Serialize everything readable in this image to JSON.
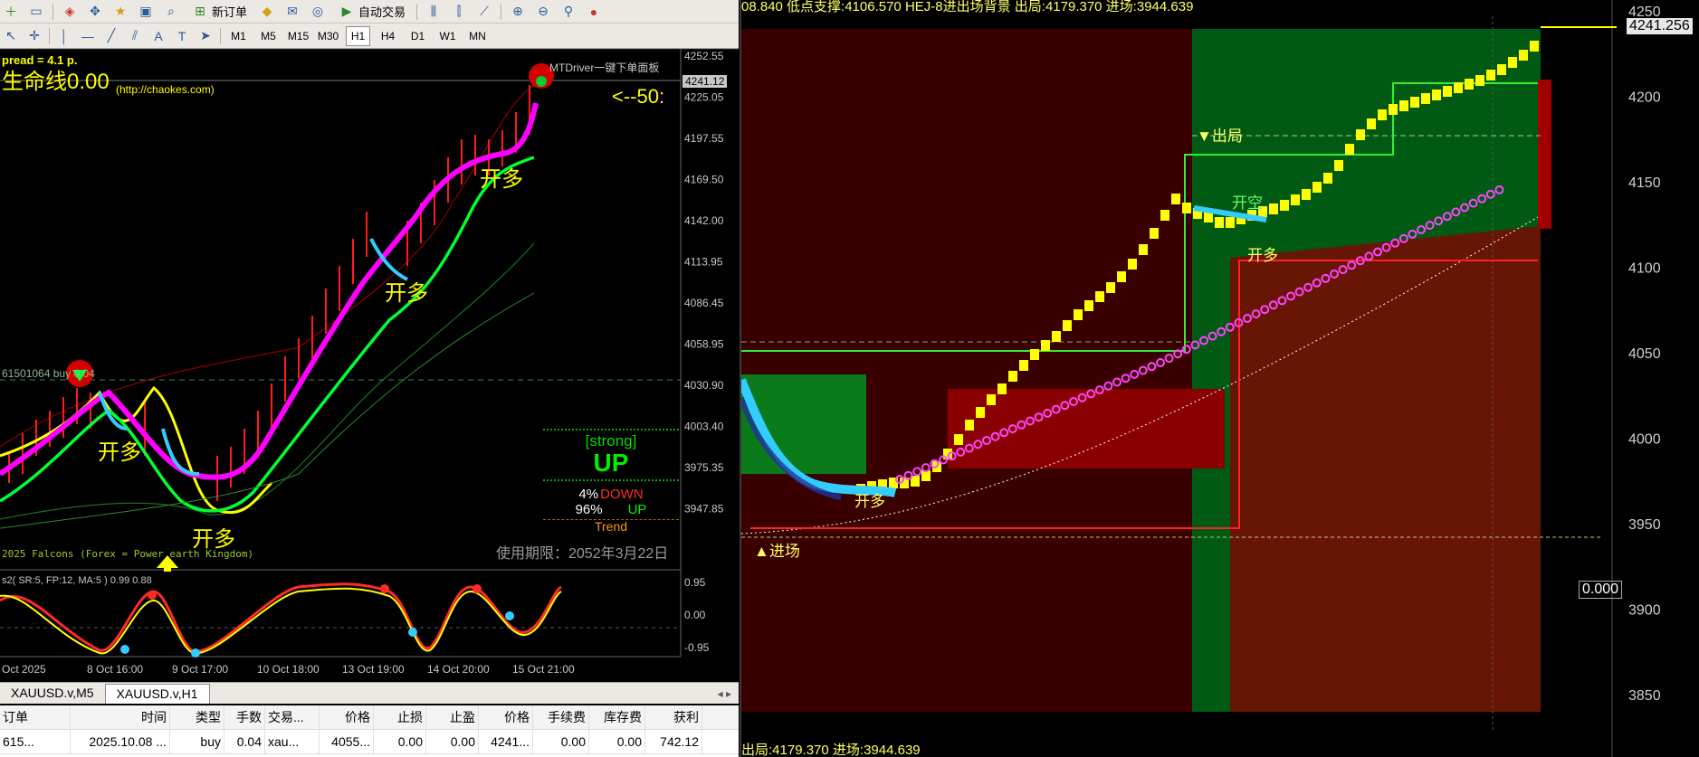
{
  "mt4": {
    "toolbar": {
      "new_order": "新订单",
      "auto_trade": "自动交易"
    },
    "timeframes": [
      "M1",
      "M5",
      "M15",
      "M30",
      "H1",
      "H4",
      "D1",
      "W1",
      "MN"
    ],
    "active_timeframe": "H1",
    "chart": {
      "spread": "pread = 4.1 p.",
      "lifeline": "生命线0.00",
      "subtitle": "(http://chaokes.com)",
      "panel_title": "MTDriver一键下单面板",
      "countdown": "<--50:",
      "ask_price": "4241.12",
      "order_line_label": "61501064 buy 0.04",
      "strength": "[strong]",
      "direction": "UP",
      "down_pct": "4%",
      "down_label": "DOWN",
      "up_pct": "96%",
      "up_label": "UP",
      "trend_label": "Trend",
      "expiry": "使用期限：2052年3月22日",
      "footer_text": "2025 Falcons (Forex = Power earth Kingdom)",
      "signals": [
        "开多",
        "开多",
        "开多",
        "开多"
      ],
      "osc_label": "s2( SR:5, FP:12, MA:5 ) 0.99 0.88",
      "price_ticks": [
        "4252.55",
        "4225.05",
        "4197.55",
        "4169.50",
        "4142.00",
        "4113.95",
        "4086.45",
        "4058.95",
        "4030.90",
        "4003.40",
        "3975.35",
        "3947.85"
      ],
      "osc_ticks": [
        "0.95",
        "0.00",
        "-0.95"
      ],
      "time_ticks": [
        "Oct 2025",
        "8 Oct 16:00",
        "9 Oct 17:00",
        "10 Oct 18:00",
        "13 Oct 19:00",
        "14 Oct 20:00",
        "15 Oct 21:00"
      ],
      "colors": {
        "up_line": "#ff00ff",
        "fast": "#00ff33",
        "slow": "#ffff00",
        "candle": "#ff0000",
        "band": "#8b0000"
      }
    },
    "tabs": [
      "XAUUSD.v,M5",
      "XAUUSD.v,H1"
    ],
    "active_tab": "XAUUSD.v,H1",
    "table": {
      "headers": [
        "订单",
        "时间",
        "类型",
        "手数",
        "交易...",
        "价格",
        "止损",
        "止盈",
        "价格",
        "手续费",
        "库存费",
        "获利"
      ],
      "rows": [
        [
          "615...",
          "2025.10.08 ...",
          "buy",
          "0.04",
          "xau...",
          "4055...",
          "0.00",
          "0.00",
          "4241...",
          "0.00",
          "0.00",
          "742.12"
        ]
      ]
    }
  },
  "right_chart": {
    "header_text": "08.840  低点支撑:4106.570  HEJ-8进出场背景  出局:4179.370  进场:3944.639",
    "footer_text": "出局:4179.370  进场:3944.639",
    "price_ticks": [
      "4250",
      "4200",
      "4150",
      "4100",
      "4050",
      "4000",
      "3950",
      "3900",
      "3850"
    ],
    "current_price": "4241.256",
    "oscillator_value": "0.000",
    "labels": {
      "exit": "▼出局",
      "entry": "▲进场",
      "open_short": "开空",
      "open_long_1": "开多",
      "open_long_2": "开多"
    }
  }
}
